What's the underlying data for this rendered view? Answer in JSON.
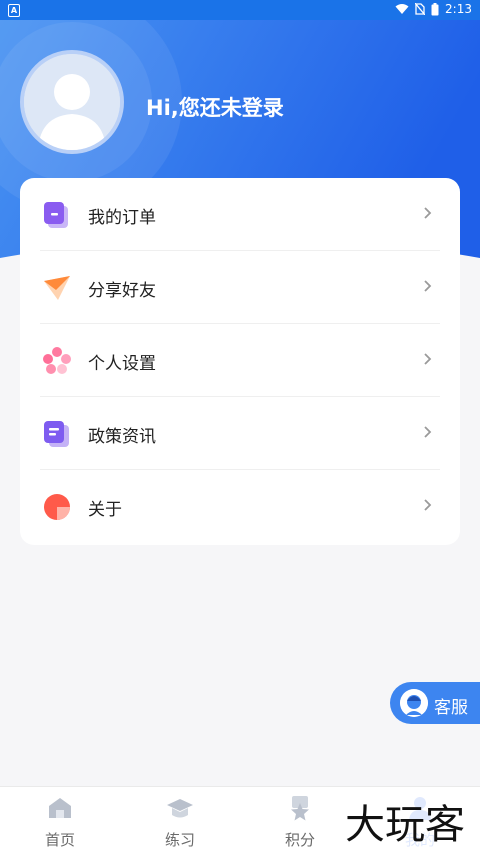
{
  "status_bar": {
    "time": "2:13"
  },
  "header": {
    "greeting": "Hi,您还未登录"
  },
  "menu": [
    {
      "label": "我的订单",
      "icon": "order-icon"
    },
    {
      "label": "分享好友",
      "icon": "share-icon"
    },
    {
      "label": "个人设置",
      "icon": "settings-icon"
    },
    {
      "label": "政策资讯",
      "icon": "news-icon"
    },
    {
      "label": "关于",
      "icon": "about-icon"
    }
  ],
  "customer_service": {
    "label": "客服"
  },
  "tabs": [
    {
      "label": "首页",
      "icon": "home-icon"
    },
    {
      "label": "练习",
      "icon": "graduation-cap-icon"
    },
    {
      "label": "积分",
      "icon": "points-icon"
    },
    {
      "label": "我的",
      "icon": "profile-icon",
      "active": true
    }
  ],
  "watermark": {
    "text": "大玩客"
  },
  "colors": {
    "primary": "#2f6ef0",
    "header_gradient_start": "#3f8df0",
    "header_gradient_end": "#1f5fe8",
    "background": "#f6f6f8"
  }
}
